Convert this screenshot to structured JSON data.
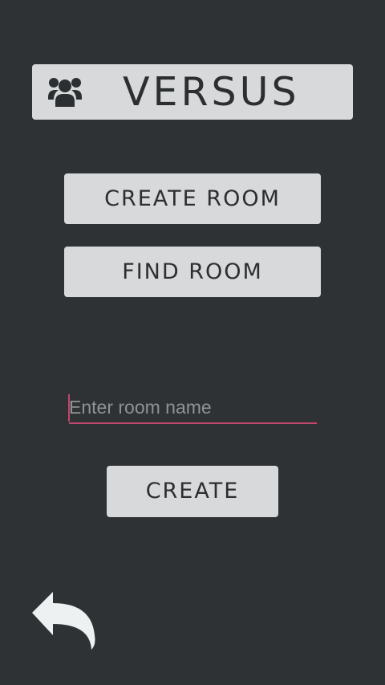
{
  "app": {
    "title": "VERSUS",
    "title_icon": "users-group-icon"
  },
  "menu": {
    "create_room_label": "CREATE ROOM",
    "find_room_label": "FIND ROOM"
  },
  "room_form": {
    "room_name_value": "",
    "room_name_placeholder": "Enter room name",
    "create_label": "CREATE"
  },
  "navigation": {
    "back_icon": "back-arrow-icon"
  },
  "colors": {
    "background": "#2f3234",
    "button_fill": "#d8d9da",
    "button_text": "#2b2f31",
    "input_accent": "#c2466d",
    "placeholder_text": "#8f9394",
    "back_icon": "#eef1f2"
  }
}
